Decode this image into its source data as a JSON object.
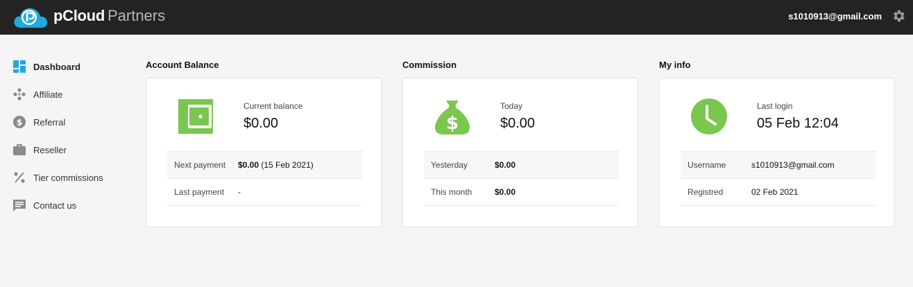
{
  "header": {
    "brand_main": "pCloud",
    "brand_sub": "Partners",
    "user_email": "s1010913@gmail.com",
    "logo_icon": "pcloud-logo-icon",
    "settings_icon": "gear-icon"
  },
  "colors": {
    "topbar": "#232323",
    "accent_green": "#7ac74f",
    "logo_blue": "#1ea9df"
  },
  "sidebar": {
    "items": [
      {
        "label": "Dashboard",
        "icon": "dashboard-icon",
        "active": true
      },
      {
        "label": "Affiliate",
        "icon": "affiliate-icon"
      },
      {
        "label": "Referral",
        "icon": "dollar-circle-icon"
      },
      {
        "label": "Reseller",
        "icon": "briefcase-icon"
      },
      {
        "label": "Tier commissions",
        "icon": "percent-icon"
      },
      {
        "label": "Contact us",
        "icon": "chat-icon"
      }
    ]
  },
  "balance": {
    "title": "Account Balance",
    "icon": "wallet-icon",
    "metric_label": "Current balance",
    "metric_value": "$0.00",
    "rows": [
      {
        "key": "Next payment",
        "value_bold": "$0.00",
        "value_extra": " (15 Feb 2021)"
      },
      {
        "key": "Last payment",
        "value": "-"
      }
    ]
  },
  "commission": {
    "title": "Commission",
    "icon": "money-bag-icon",
    "metric_label": "Today",
    "metric_value": "$0.00",
    "rows": [
      {
        "key": "Yesterday",
        "value_bold": "$0.00"
      },
      {
        "key": "This month",
        "value_bold": "$0.00"
      }
    ]
  },
  "myinfo": {
    "title": "My info",
    "icon": "clock-icon",
    "metric_label": "Last login",
    "metric_value": "05 Feb 12:04",
    "rows": [
      {
        "key": "Username",
        "value": "s1010913@gmail.com"
      },
      {
        "key": "Registred",
        "value": "02 Feb 2021"
      }
    ]
  }
}
